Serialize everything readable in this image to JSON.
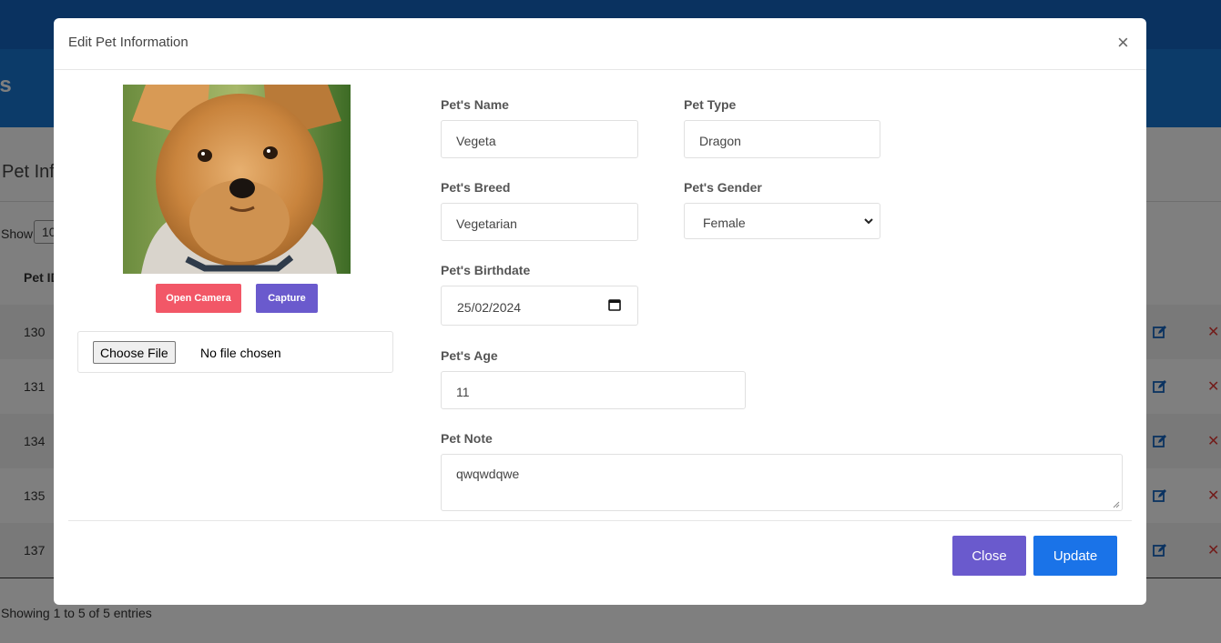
{
  "background": {
    "banner_title": "ets",
    "card_title": "Pet Inf",
    "show_label": "Show",
    "show_value": "10",
    "table_header_id": "Pet ID",
    "rows": [
      {
        "id": "130"
      },
      {
        "id": "131"
      },
      {
        "id": "134"
      },
      {
        "id": "135"
      },
      {
        "id": "137"
      }
    ],
    "showing_text": "Showing 1 to 5 of 5 entries"
  },
  "modal": {
    "title": "Edit Pet Information",
    "close_symbol": "×",
    "photo": {
      "open_camera_label": "Open Camera",
      "capture_label": "Capture",
      "choose_file_label": "Choose File",
      "no_file_text": "No file chosen"
    },
    "fields": {
      "name": {
        "label": "Pet's Name",
        "value": "Vegeta"
      },
      "type": {
        "label": "Pet Type",
        "value": "Dragon"
      },
      "breed": {
        "label": "Pet's Breed",
        "value": "Vegetarian"
      },
      "gender": {
        "label": "Pet's Gender",
        "value": "Female"
      },
      "birthdate": {
        "label": "Pet's Birthdate",
        "value": "25/02/2024"
      },
      "age": {
        "label": "Pet's Age",
        "value": "11"
      },
      "note": {
        "label": "Pet Note",
        "value": "qwqwdqwe"
      }
    },
    "footer": {
      "close_label": "Close",
      "update_label": "Update"
    }
  },
  "colors": {
    "open_camera": "#f25767",
    "capture": "#6a5acd",
    "close": "#6a5acd",
    "update": "#1a73e8",
    "edit_icon": "#1565c0",
    "delete_icon": "#e53935"
  },
  "icons": {
    "edit": "edit-icon",
    "delete": "delete-icon",
    "calendar": "calendar-icon",
    "select": "chevron-down-icon"
  }
}
